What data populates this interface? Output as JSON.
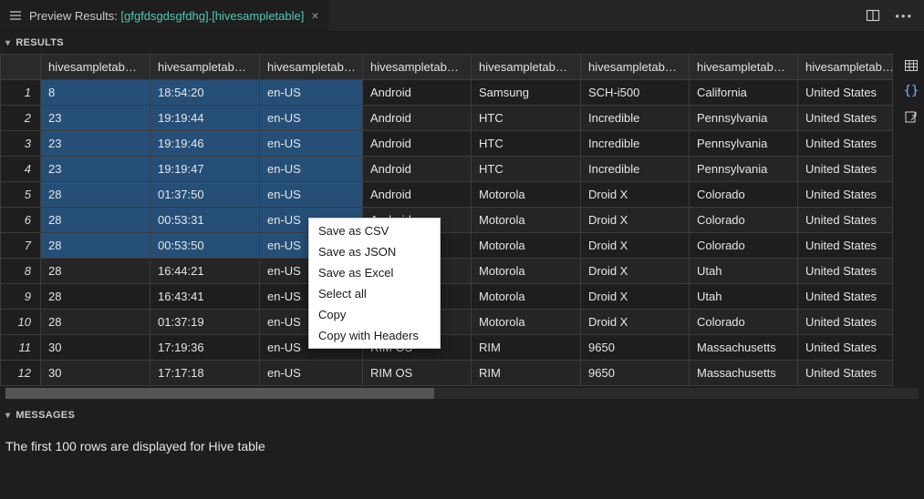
{
  "tab": {
    "prefix": "Preview Results: ",
    "group1": "[gfgfdsgdsgfdhg]",
    "dot": ".",
    "group2": "[hivesampletable]"
  },
  "sections": {
    "results": "RESULTS",
    "messages": "MESSAGES"
  },
  "columns": [
    "hivesampletab…",
    "hivesampletab…",
    "hivesampletab…",
    "hivesampletab…",
    "hivesampletab…",
    "hivesampletab…",
    "hivesampletab…",
    "hivesampletab…"
  ],
  "selection": {
    "rows": [
      0,
      1,
      2,
      3,
      4,
      5,
      6
    ],
    "cols": [
      0,
      1,
      2
    ]
  },
  "rows": [
    [
      "8",
      "18:54:20",
      "en-US",
      "Android",
      "Samsung",
      "SCH-i500",
      "California",
      "United States"
    ],
    [
      "23",
      "19:19:44",
      "en-US",
      "Android",
      "HTC",
      "Incredible",
      "Pennsylvania",
      "United States"
    ],
    [
      "23",
      "19:19:46",
      "en-US",
      "Android",
      "HTC",
      "Incredible",
      "Pennsylvania",
      "United States"
    ],
    [
      "23",
      "19:19:47",
      "en-US",
      "Android",
      "HTC",
      "Incredible",
      "Pennsylvania",
      "United States"
    ],
    [
      "28",
      "01:37:50",
      "en-US",
      "Android",
      "Motorola",
      "Droid X",
      "Colorado",
      "United States"
    ],
    [
      "28",
      "00:53:31",
      "en-US",
      "Android",
      "Motorola",
      "Droid X",
      "Colorado",
      "United States"
    ],
    [
      "28",
      "00:53:50",
      "en-US",
      "",
      "Motorola",
      "Droid X",
      "Colorado",
      "United States"
    ],
    [
      "28",
      "16:44:21",
      "en-US",
      "",
      "Motorola",
      "Droid X",
      "Utah",
      "United States"
    ],
    [
      "28",
      "16:43:41",
      "en-US",
      "",
      "Motorola",
      "Droid X",
      "Utah",
      "United States"
    ],
    [
      "28",
      "01:37:19",
      "en-US",
      "",
      "Motorola",
      "Droid X",
      "Colorado",
      "United States"
    ],
    [
      "30",
      "17:19:36",
      "en-US",
      "RIM OS",
      "RIM",
      "9650",
      "Massachusetts",
      "United States"
    ],
    [
      "30",
      "17:17:18",
      "en-US",
      "RIM OS",
      "RIM",
      "9650",
      "Massachusetts",
      "United States"
    ]
  ],
  "context_menu": [
    "Save as CSV",
    "Save as JSON",
    "Save as Excel",
    "Select all",
    "Copy",
    "Copy with Headers"
  ],
  "message_text": "The first 100 rows are displayed for Hive table",
  "side_icons": [
    "table-icon",
    "braces-icon",
    "export-icon"
  ]
}
